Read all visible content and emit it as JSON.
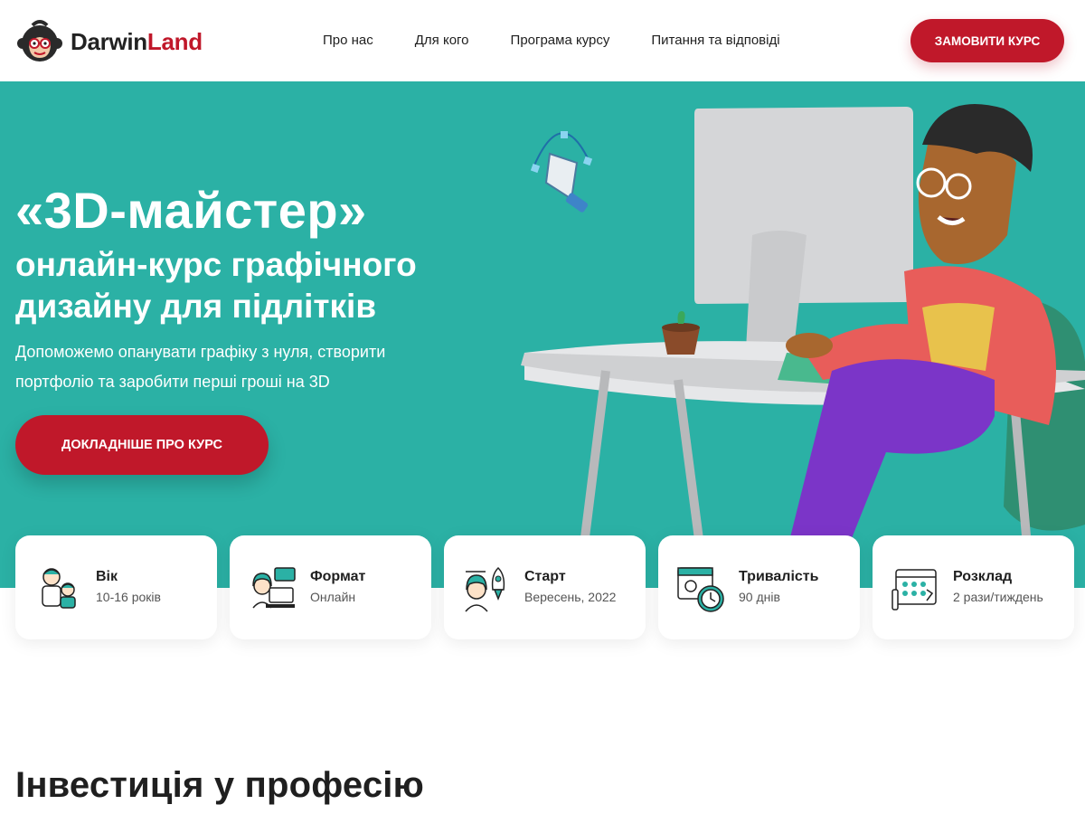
{
  "header": {
    "logo": {
      "part1": "Darwin",
      "part2": "Land"
    },
    "nav": [
      "Про нас",
      "Для кого",
      "Програма курсу",
      "Питання та відповіді"
    ],
    "order_button": "ЗАМОВИТИ КУРС"
  },
  "hero": {
    "title": "«3D-майстер»",
    "subtitle_line1": "онлайн-курс графічного",
    "subtitle_line2": "дизайну для підлітків",
    "desc_line1": "Допоможемо опанувати графіку з нуля, створити",
    "desc_line2": "портфоліо та заробити перші гроші на 3D",
    "cta": "ДОКЛАДНІШЕ ПРО КУРС"
  },
  "cards": [
    {
      "title": "Вік",
      "value": "10-16 років",
      "icon": "kids-icon"
    },
    {
      "title": "Формат",
      "value": "Онлайн",
      "icon": "online-format-icon"
    },
    {
      "title": "Старт",
      "value": "Вересень, 2022",
      "icon": "rocket-start-icon"
    },
    {
      "title": "Тривалість",
      "value": "90 днів",
      "icon": "clock-duration-icon"
    },
    {
      "title": "Розклад",
      "value": "2 рази/тиждень",
      "icon": "calendar-schedule-icon"
    }
  ],
  "section": {
    "title": "Інвестиція у професію"
  },
  "colors": {
    "accent": "#c0182a",
    "teal": "#2bb1a5"
  }
}
